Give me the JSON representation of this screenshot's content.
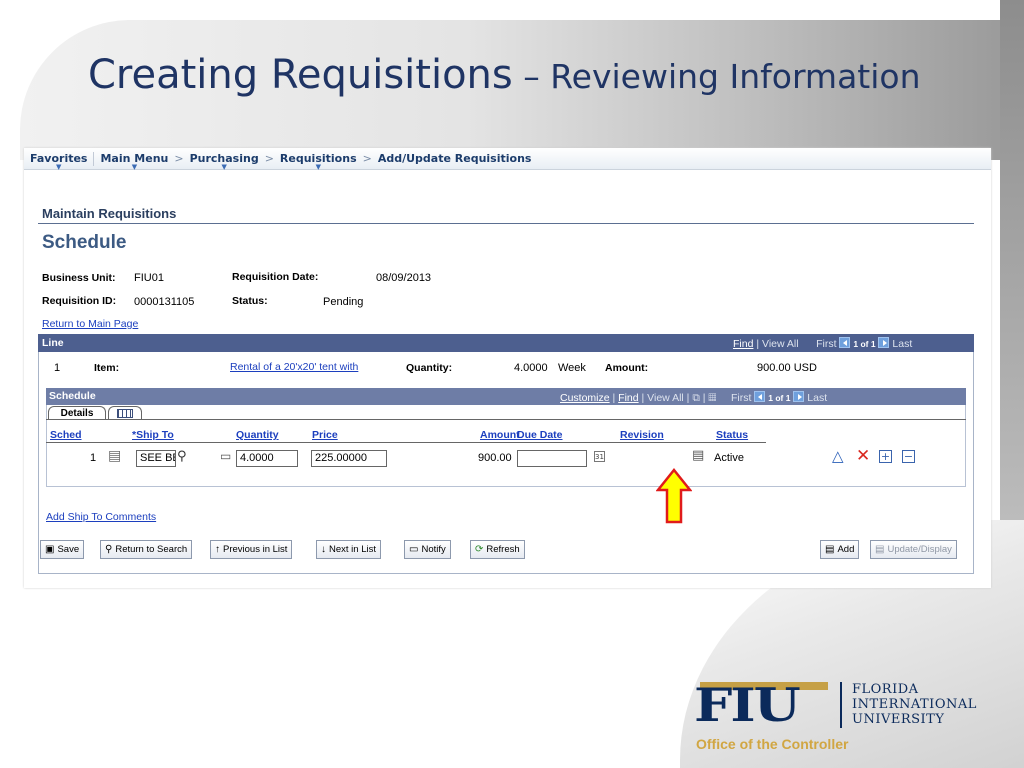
{
  "slide": {
    "title_main": "Creating Requisitions",
    "title_sub": " – Reviewing Information"
  },
  "nav": {
    "items": [
      "Favorites",
      "Main Menu",
      "Purchasing",
      "Requisitions",
      "Add/Update Requisitions"
    ],
    "separator": ">"
  },
  "page": {
    "heading": "Maintain Requisitions",
    "title": "Schedule"
  },
  "fields": {
    "business_unit_label": "Business Unit:",
    "business_unit_value": "FIU01",
    "req_date_label": "Requisition Date:",
    "req_date_value": "08/09/2013",
    "req_id_label": "Requisition ID:",
    "req_id_value": "0000131105",
    "status_label": "Status:",
    "status_value": "Pending",
    "return_link": "Return to Main Page"
  },
  "line_grid": {
    "title": "Line",
    "find": "Find",
    "view_all": "View All",
    "first": "First",
    "of_text": "1 of 1",
    "last": "Last",
    "line_no": "1",
    "item_label": "Item:",
    "item_value": "Rental of a 20'x20' tent with",
    "quantity_label": "Quantity:",
    "quantity_value": "4.0000",
    "uom": "Week",
    "amount_label": "Amount:",
    "amount_value": "900.00 USD"
  },
  "schedule_grid": {
    "title": "Schedule",
    "customize": "Customize",
    "find": "Find",
    "view_all": "View All",
    "first": "First",
    "of_text": "1 of 1",
    "last": "Last",
    "tab_details": "Details",
    "columns": {
      "sched": "Sched",
      "ship_to": "*Ship To",
      "quantity": "Quantity",
      "price": "Price",
      "amount": "Amount",
      "due_date": "Due Date",
      "revision": "Revision",
      "status": "Status"
    },
    "row": {
      "sched": "1",
      "ship_to": "SEE BE",
      "quantity": "4.0000",
      "price": "225.00000",
      "amount": "900.00",
      "due_date": "",
      "status": "Active"
    }
  },
  "add_ship_comments": "Add Ship To Comments",
  "buttons": {
    "save": "Save",
    "return_search": "Return to Search",
    "previous": "Previous in List",
    "next": "Next in List",
    "notify": "Notify",
    "refresh": "Refresh",
    "add": "Add",
    "update": "Update/Display"
  },
  "logo": {
    "letters": "FIU",
    "line1": "FLORIDA",
    "line2": "INTERNATIONAL",
    "line3": "UNIVERSITY",
    "office": "Office of the Controller"
  },
  "colors": {
    "title": "#1f3464",
    "grid_header": "#4d5f8f",
    "link": "#1c3fbe",
    "arrow_fill": "#ffff00",
    "arrow_stroke": "#e01b1b",
    "logo_navy": "#0b2a5b",
    "logo_gold": "#c6a045"
  }
}
